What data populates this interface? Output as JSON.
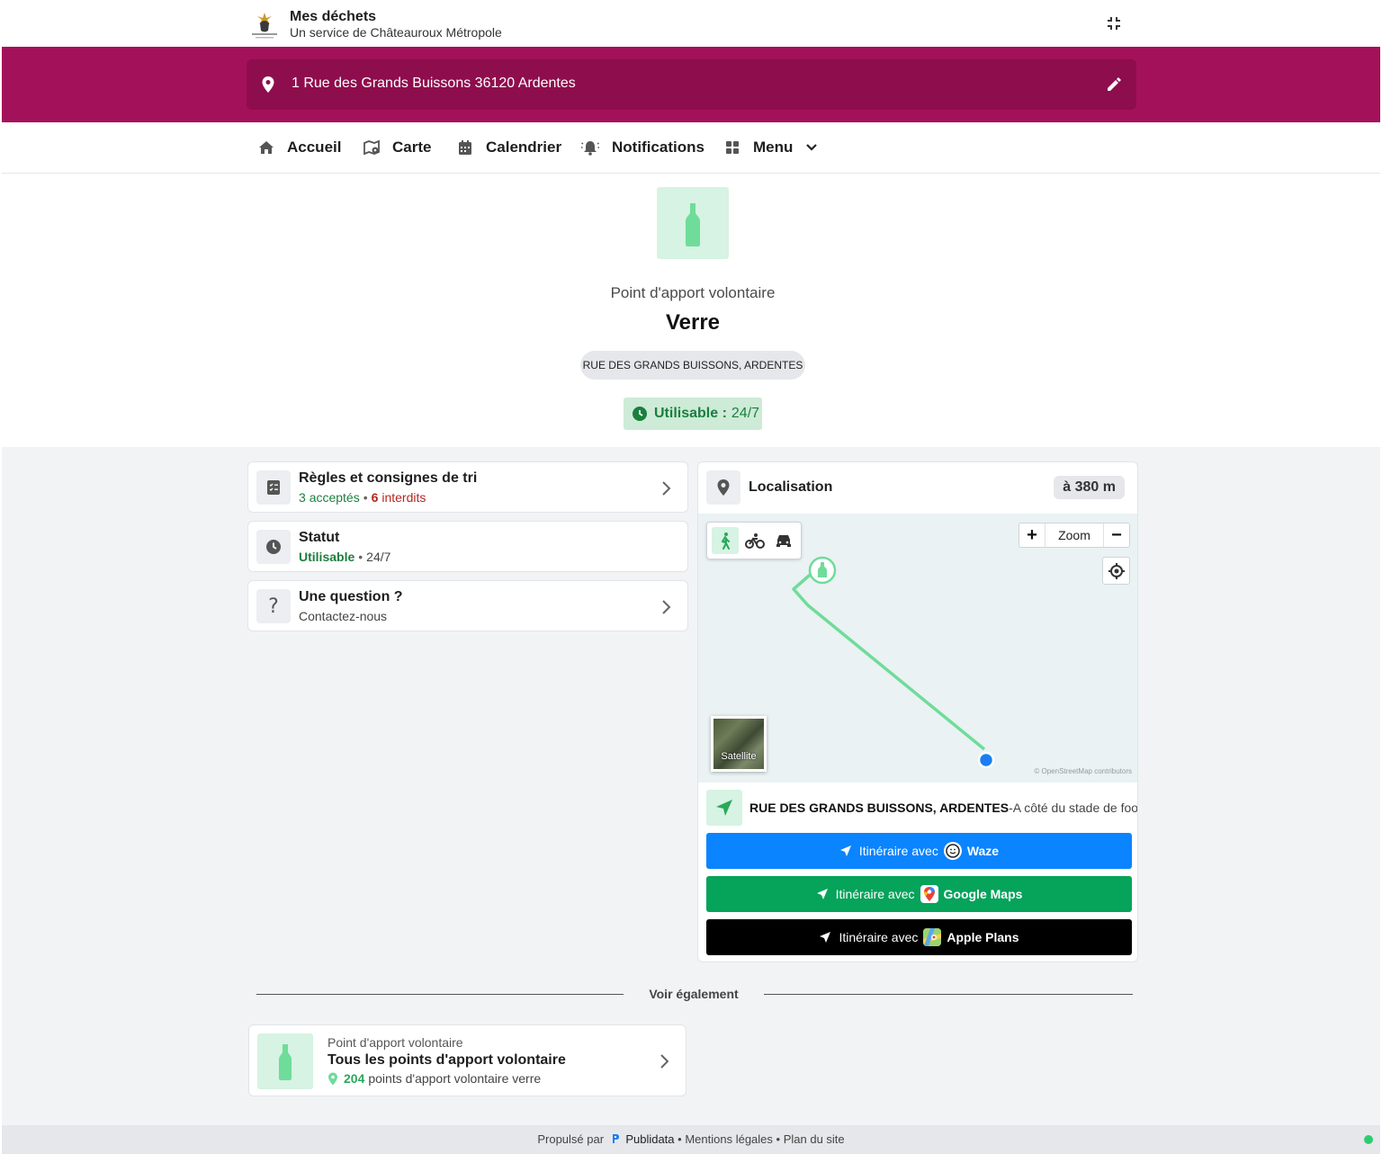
{
  "header": {
    "app_title": "Mes déchets",
    "app_subtitle": "Un service de Châteauroux Métropole",
    "logo_name": "chateauroux-metropole-logo"
  },
  "address": {
    "value": "1 Rue des Grands Buissons 36120 Ardentes"
  },
  "nav": {
    "items": [
      {
        "label": "Accueil",
        "icon": "home-icon"
      },
      {
        "label": "Carte",
        "icon": "map-icon"
      },
      {
        "label": "Calendrier",
        "icon": "calendar-icon"
      },
      {
        "label": "Notifications",
        "icon": "bell-icon"
      },
      {
        "label": "Menu",
        "icon": "grid-icon"
      }
    ]
  },
  "hero": {
    "kicker": "Point d'apport volontaire",
    "title": "Verre",
    "location_chip": "RUE DES GRANDS BUISSONS, ARDENTES",
    "status_label": "Utilisable :",
    "status_value": "24/7"
  },
  "cards": {
    "rules": {
      "title": "Règles et consignes de tri",
      "accepted_count": "3",
      "accepted_label": "acceptés",
      "forbidden_count": "6",
      "forbidden_label": "interdits"
    },
    "status": {
      "title": "Statut",
      "state": "Utilisable",
      "hours": "24/7"
    },
    "question": {
      "title": "Une question ?",
      "subtitle": "Contactez-nous"
    }
  },
  "localisation": {
    "title": "Localisation",
    "distance": "à 380 m",
    "map": {
      "zoom_label": "Zoom",
      "satellite_label": "Satellite",
      "attribution": "© OpenStreetMap contributors",
      "modes": [
        "walk-icon",
        "bike-icon",
        "car-icon"
      ],
      "active_mode": "walk"
    },
    "place_name": "RUE DES GRANDS BUISSONS, ARDENTES",
    "place_note": "-A côté du stade de foot",
    "routes": [
      {
        "prefix": "Itinéraire avec",
        "app": "Waze",
        "color": "#0a84ff"
      },
      {
        "prefix": "Itinéraire avec",
        "app": "Google Maps",
        "color": "#06a35b"
      },
      {
        "prefix": "Itinéraire avec",
        "app": "Apple Plans",
        "color": "#000000"
      }
    ]
  },
  "see_also": {
    "label": "Voir également",
    "card": {
      "kicker": "Point d'apport volontaire",
      "title": "Tous les points d'apport volontaire",
      "count": "204",
      "count_label": "points d'apport volontaire verre"
    }
  },
  "footer": {
    "powered_by": "Propulsé par",
    "brand": "Publidata",
    "legal": "Mentions légales",
    "sitemap": "Plan du site",
    "sep": "•"
  },
  "colors": {
    "brand": "#a3115a",
    "brand_dark": "#8e0d4d",
    "glass_green": "#6fdc9a",
    "status_green": "#1b7f3e"
  }
}
